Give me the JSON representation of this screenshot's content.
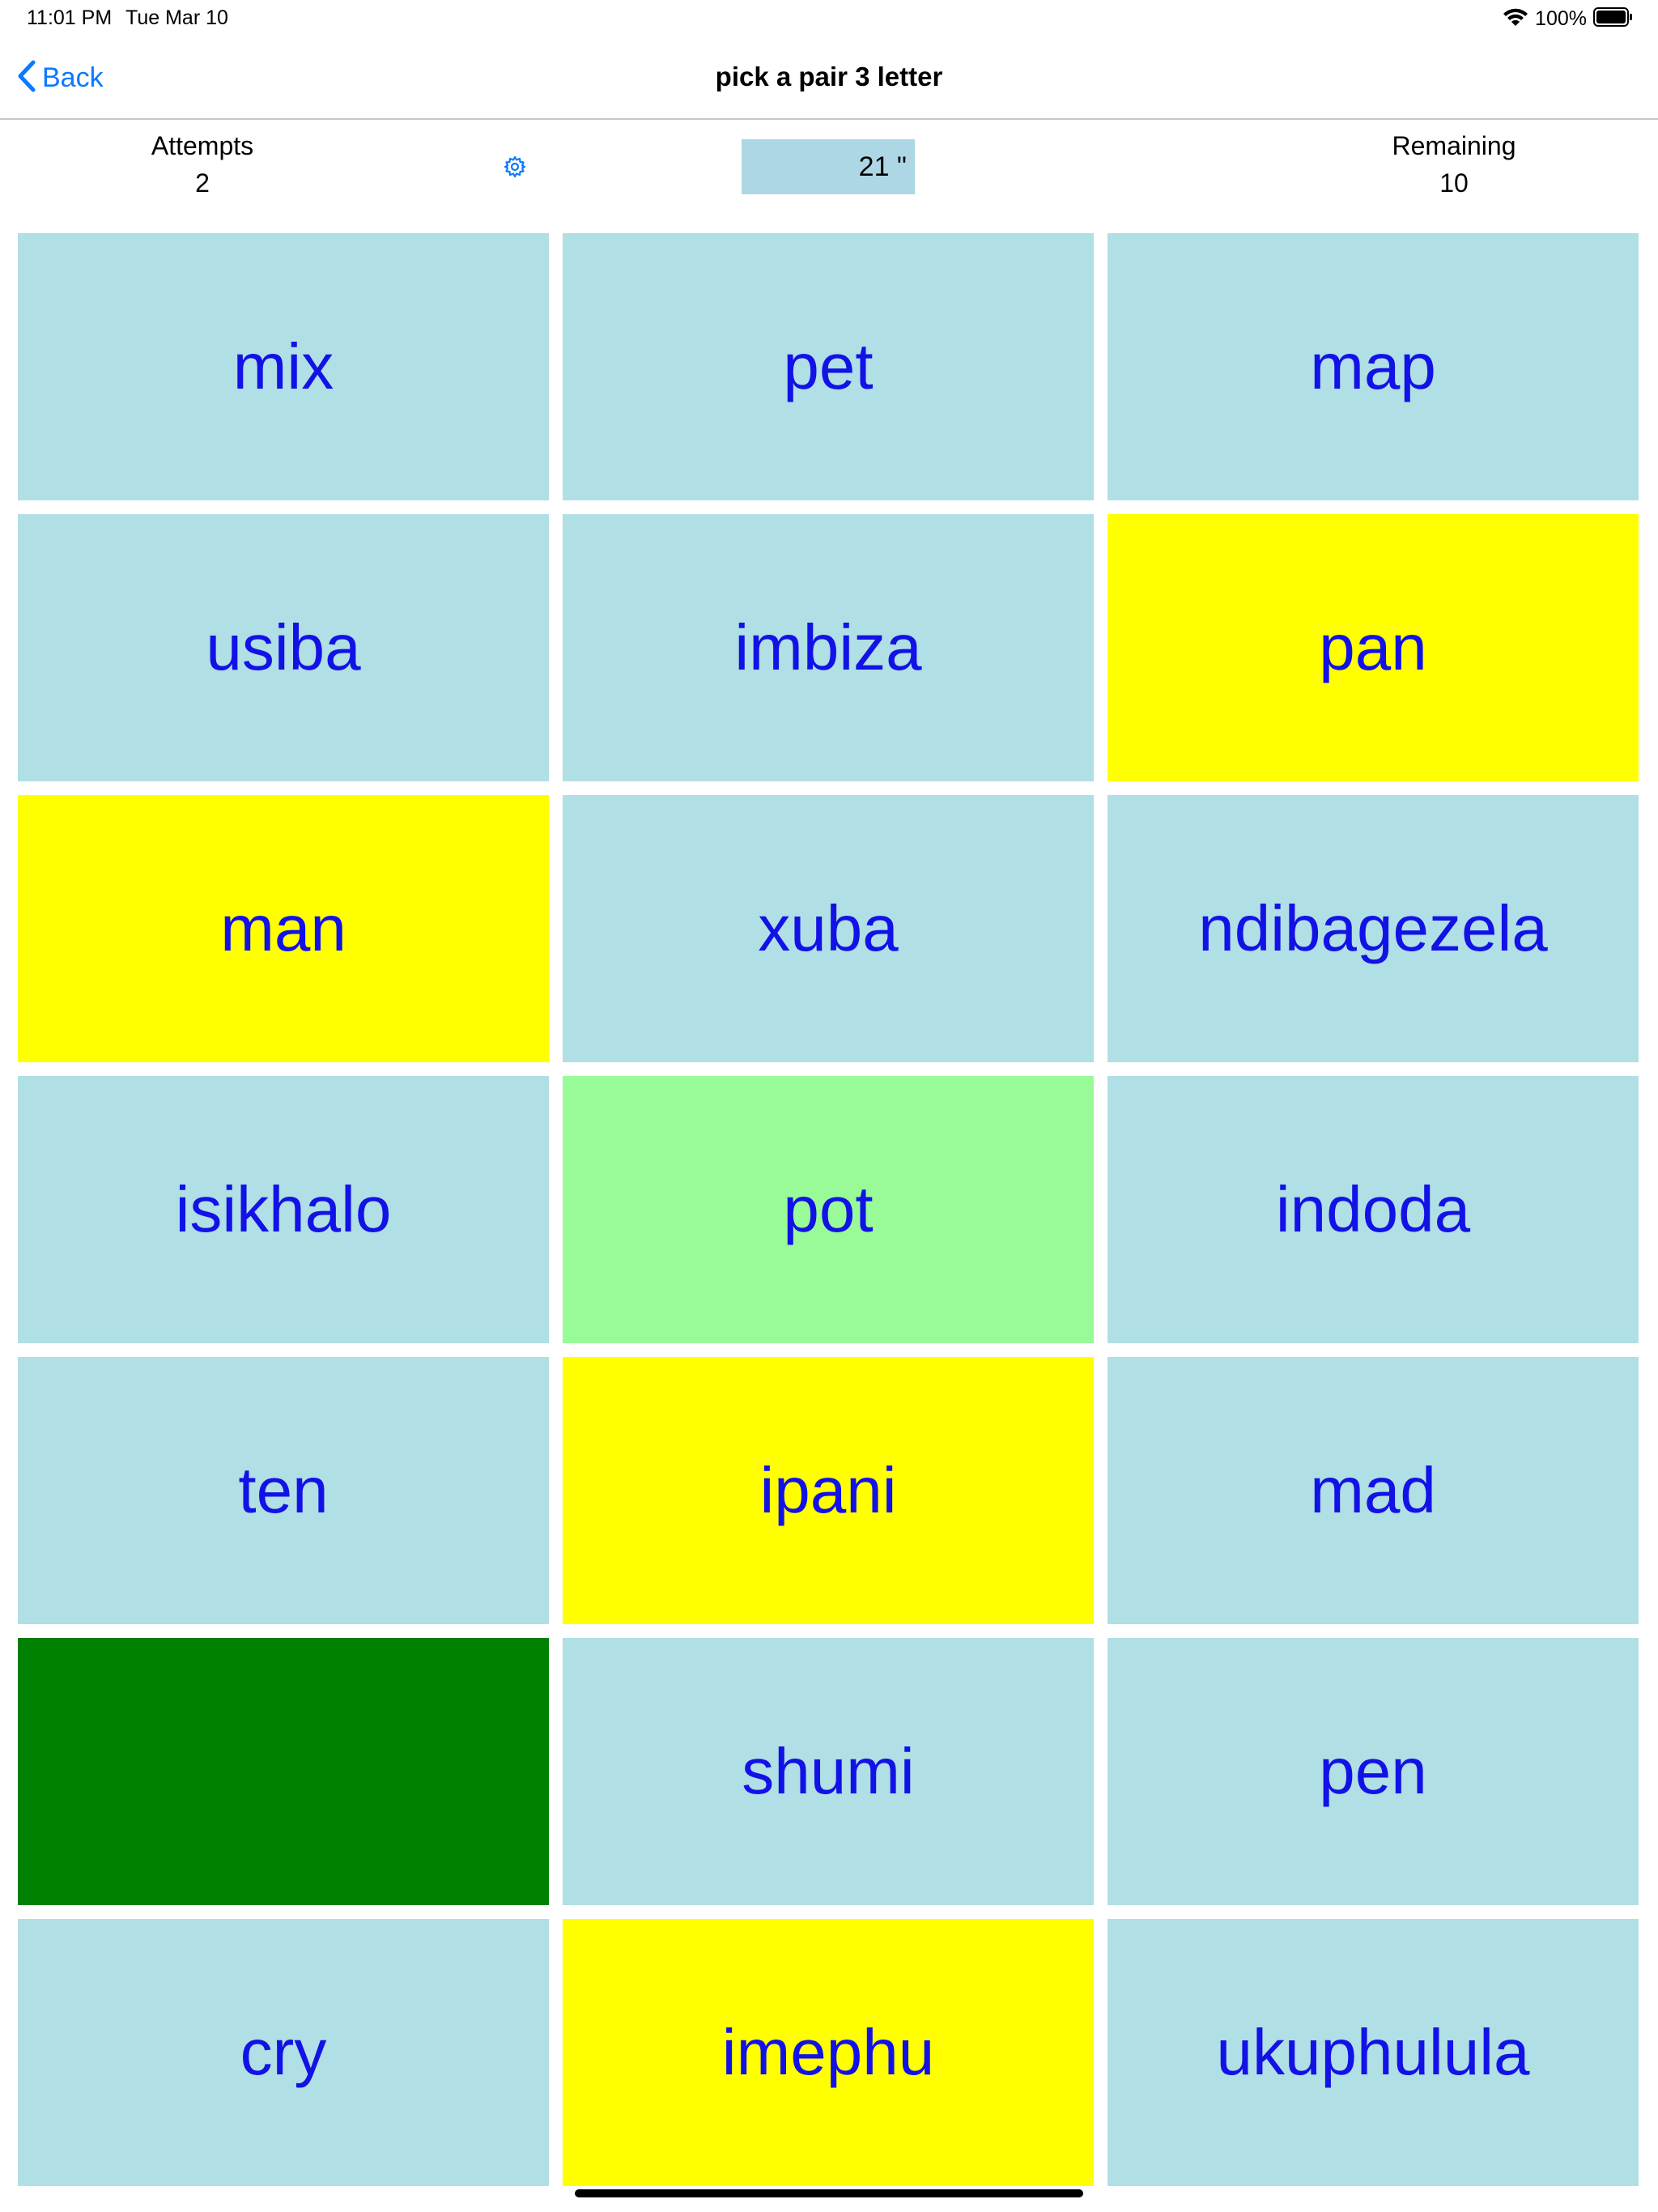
{
  "status_bar": {
    "time": "11:01 PM",
    "date": "Tue Mar 10",
    "battery": "100%",
    "icons": [
      "wifi-icon",
      "battery-icon"
    ]
  },
  "nav": {
    "back_label": "Back",
    "title": "pick a pair 3 letter"
  },
  "stats": {
    "attempts_label": "Attempts",
    "attempts_value": "2",
    "timer": "21 \"",
    "remaining_label": "Remaining",
    "remaining_value": "10"
  },
  "colors": {
    "tile_default": "#b0dfe5",
    "tile_selected": "#ffff00",
    "tile_matched_light": "#98fb98",
    "tile_matched_dark": "#008000",
    "word_text": "#1212e6",
    "accent": "#0a7aff",
    "timer_bg": "#aed7e6"
  },
  "tiles": [
    {
      "word": "mix",
      "state": "default"
    },
    {
      "word": "pet",
      "state": "default"
    },
    {
      "word": "map",
      "state": "default"
    },
    {
      "word": "usiba",
      "state": "default"
    },
    {
      "word": "imbiza",
      "state": "default"
    },
    {
      "word": "pan",
      "state": "selected"
    },
    {
      "word": "man",
      "state": "selected"
    },
    {
      "word": "xuba",
      "state": "default"
    },
    {
      "word": "ndibagezela",
      "state": "default"
    },
    {
      "word": "isikhalo",
      "state": "default"
    },
    {
      "word": "pot",
      "state": "matched-light"
    },
    {
      "word": "indoda",
      "state": "default"
    },
    {
      "word": "ten",
      "state": "default"
    },
    {
      "word": "ipani",
      "state": "selected"
    },
    {
      "word": "mad",
      "state": "default"
    },
    {
      "word": "",
      "state": "matched-dark"
    },
    {
      "word": "shumi",
      "state": "default"
    },
    {
      "word": "pen",
      "state": "default"
    },
    {
      "word": "cry",
      "state": "default"
    },
    {
      "word": "imephu",
      "state": "selected"
    },
    {
      "word": "ukuphulula",
      "state": "default"
    }
  ]
}
